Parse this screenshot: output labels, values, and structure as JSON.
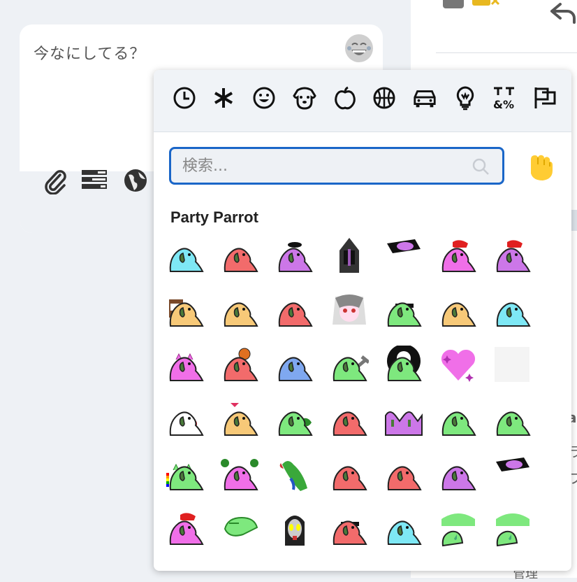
{
  "composer": {
    "placeholder": "今なにしてる？"
  },
  "right_panel": {
    "cut_text_1": "a",
    "cut_text_2": "ラ",
    "cut_text_3": "フ",
    "cut_text_4": "管",
    "bottom_text": "管理"
  },
  "picker": {
    "categories": [
      "recent-icon",
      "asterisk-icon",
      "smile-icon",
      "dog-icon",
      "apple-icon",
      "basketball-icon",
      "car-icon",
      "lightbulb-icon",
      "symbols-icon",
      "flags-icon"
    ],
    "search": {
      "placeholder": "検索..."
    },
    "skin_tone_icon": "raised-fist-icon",
    "section_title": "Party Parrot",
    "colors": {
      "accent": "#1a66c8",
      "parrot_green": "#7ee87e",
      "parrot_red": "#f26b6b",
      "parrot_pink": "#f06fe8",
      "parrot_purple": "#cc77e8",
      "parrot_orange": "#f7c978",
      "parrot_cyan": "#7ee8f5",
      "parrot_blue": "#7fa8f0"
    },
    "emojis": [
      [
        "cyan",
        "red",
        "purple-hat",
        "knight",
        "slit",
        "santa-pink",
        "santa-purple"
      ],
      [
        "coffee",
        "orange",
        "red",
        "anime",
        "green-shades",
        "orange",
        "cyan"
      ],
      [
        "pink-cat",
        "red-wand",
        "blue",
        "green-hammer",
        "green-circle",
        "heart",
        "blank"
      ],
      [
        "white",
        "orange-heart",
        "green-leaf",
        "red",
        "purple-double",
        "green",
        "green"
      ],
      [
        "cat-rainbow",
        "pink-swirl",
        "real",
        "red",
        "red",
        "purple-bone",
        "slit"
      ],
      [
        "santa-pink",
        "green-sleep",
        "ultraman",
        "red-shades",
        "cyan",
        "green-peek",
        "green-peek"
      ]
    ]
  }
}
